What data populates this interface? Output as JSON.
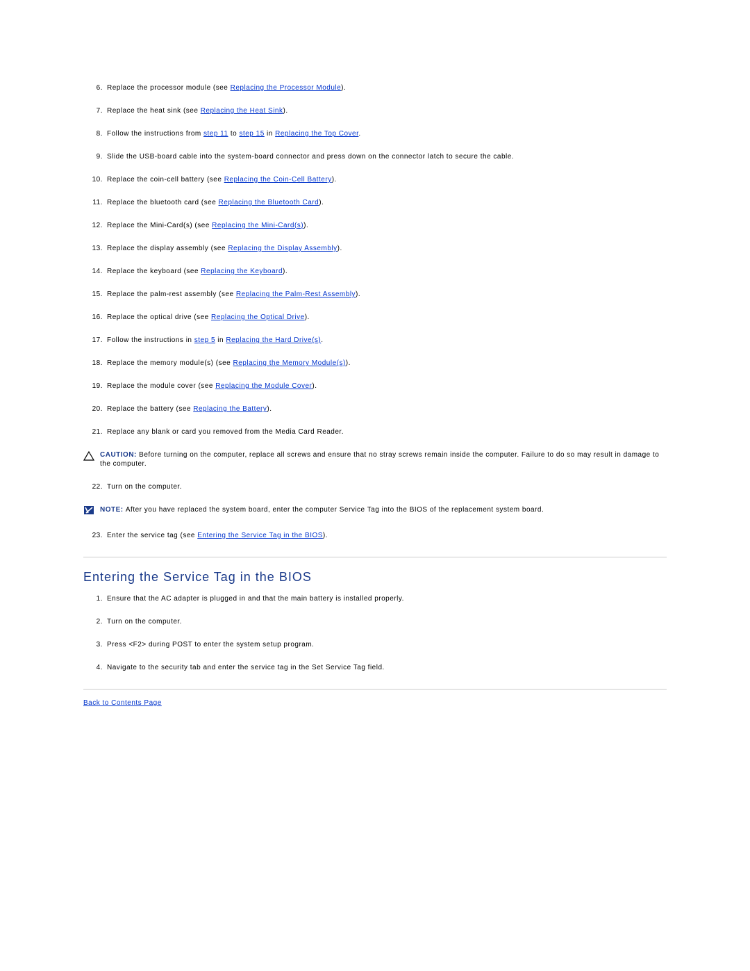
{
  "list1": {
    "s6": {
      "num": "6.",
      "a": "Replace the processor module (see ",
      "l1": "Replacing the Processor Module",
      "b": ")."
    },
    "s7": {
      "num": "7.",
      "a": "Replace the heat sink (see ",
      "l1": "Replacing the Heat Sink",
      "b": ")."
    },
    "s8": {
      "num": "8.",
      "a": "Follow the instructions from ",
      "l1": "step 11",
      "b": " to ",
      "l2": "step 15",
      "c": " in ",
      "l3": "Replacing the Top Cover",
      "d": "."
    },
    "s9": {
      "num": "9.",
      "a": "Slide the USB-board cable into the system-board connector and press down on the connector latch to secure the cable."
    },
    "s10": {
      "num": "10.",
      "a": "Replace the coin-cell battery (see ",
      "l1": "Replacing the Coin-Cell Battery",
      "b": ")."
    },
    "s11": {
      "num": "11.",
      "a": "Replace the bluetooth card (see ",
      "l1": "Replacing the Bluetooth Card",
      "b": ")."
    },
    "s12": {
      "num": "12.",
      "a": "Replace the Mini-Card(s) (see ",
      "l1": "Replacing the Mini-Card(s)",
      "b": ")."
    },
    "s13": {
      "num": "13.",
      "a": "Replace the display assembly (see ",
      "l1": "Replacing the Display Assembly",
      "b": ")."
    },
    "s14": {
      "num": "14.",
      "a": "Replace the keyboard (see ",
      "l1": "Replacing the Keyboard",
      "b": ")."
    },
    "s15": {
      "num": "15.",
      "a": "Replace the palm-rest assembly (see ",
      "l1": "Replacing the Palm-Rest Assembly",
      "b": ")."
    },
    "s16": {
      "num": "16.",
      "a": "Replace the optical drive (see ",
      "l1": "Replacing the Optical Drive",
      "b": ")."
    },
    "s17": {
      "num": "17.",
      "a": "Follow the instructions in ",
      "l1": "step 5",
      "b": " in ",
      "l2": "Replacing the Hard Drive(s)",
      "c": "."
    },
    "s18": {
      "num": "18.",
      "a": "Replace the memory module(s) (see ",
      "l1": "Replacing the Memory Module(s)",
      "b": ")."
    },
    "s19": {
      "num": "19.",
      "a": "Replace the module cover (see ",
      "l1": "Replacing the Module Cover",
      "b": ")."
    },
    "s20": {
      "num": "20.",
      "a": "Replace the battery (see ",
      "l1": "Replacing the Battery",
      "b": ")."
    },
    "s21": {
      "num": "21.",
      "a": "Replace any blank or card you removed from the Media Card Reader."
    },
    "s22": {
      "num": "22.",
      "a": "Turn on the computer."
    },
    "s23": {
      "num": "23.",
      "a": "Enter the service tag (see ",
      "l1": "Entering the Service Tag in the BIOS",
      "b": ")."
    }
  },
  "caution": {
    "label": "CAUTION: ",
    "text": "Before turning on the computer, replace all screws and ensure that no stray screws remain inside the computer. Failure to do so may result in damage to the computer."
  },
  "note": {
    "label": "NOTE: ",
    "text": "After you have replaced the system board, enter the computer Service Tag into the BIOS of the replacement system board."
  },
  "section_heading": "Entering the Service Tag in the BIOS",
  "list2": {
    "s1": {
      "num": "1.",
      "a": "Ensure that the AC adapter is plugged in and that the main battery is installed properly."
    },
    "s2": {
      "num": "2.",
      "a": "Turn on the computer."
    },
    "s3": {
      "num": "3.",
      "a": "Press <F2> during POST to enter the system setup program."
    },
    "s4": {
      "num": "4.",
      "a": "Navigate to the security tab and enter the service tag in the Set Service Tag field."
    }
  },
  "back_link": "Back to Contents Page"
}
